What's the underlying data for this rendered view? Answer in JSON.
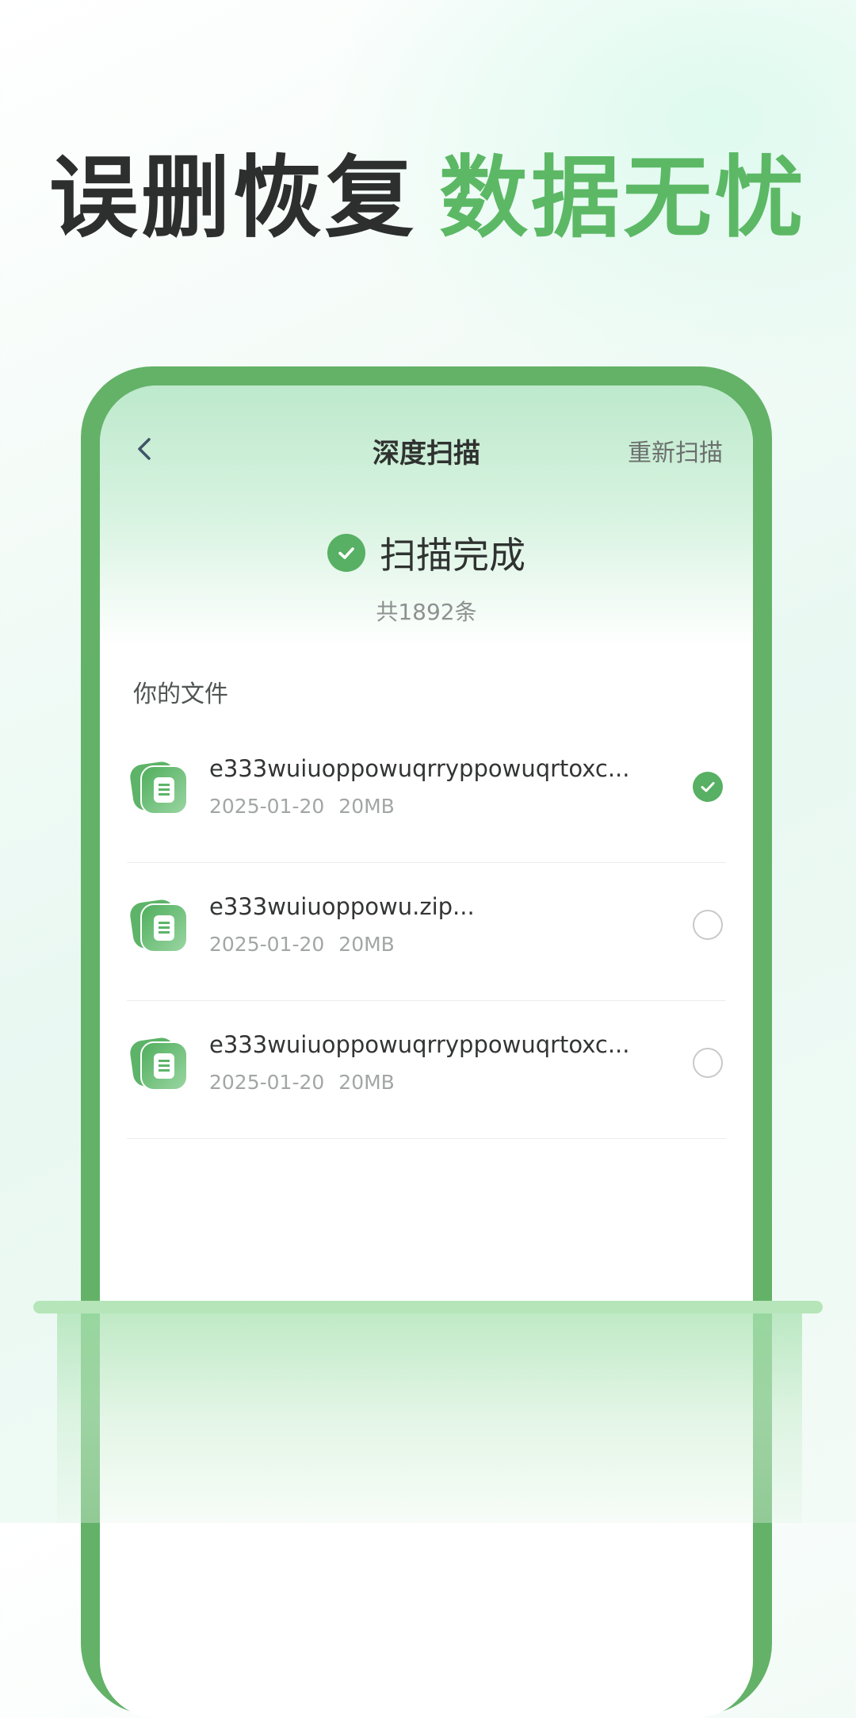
{
  "headline": {
    "dark": "误删恢复",
    "green": "数据无忧"
  },
  "navbar": {
    "back_icon": "chevron-left-icon",
    "title": "深度扫描",
    "rescan_label": "重新扫描"
  },
  "status": {
    "icon": "check-circle-icon",
    "text": "扫描完成",
    "count": "共1892条"
  },
  "section_label": "你的文件",
  "files": [
    {
      "name": "e333wuiuoppowuqrryppowuqrtoxc...",
      "date": "2025-01-20",
      "size": "20MB",
      "selected": true
    },
    {
      "name": "e333wuiuoppowu.zip...",
      "date": "2025-01-20",
      "size": "20MB",
      "selected": false
    },
    {
      "name": "e333wuiuoppowuqrryppowuqrtoxc...",
      "date": "2025-01-20",
      "size": "20MB",
      "selected": false
    }
  ],
  "colors": {
    "accent": "#5cb865",
    "phone_frame": "#63b268",
    "headline_dark": "#2d2f2e",
    "scan_line": "#b5e5b9"
  }
}
